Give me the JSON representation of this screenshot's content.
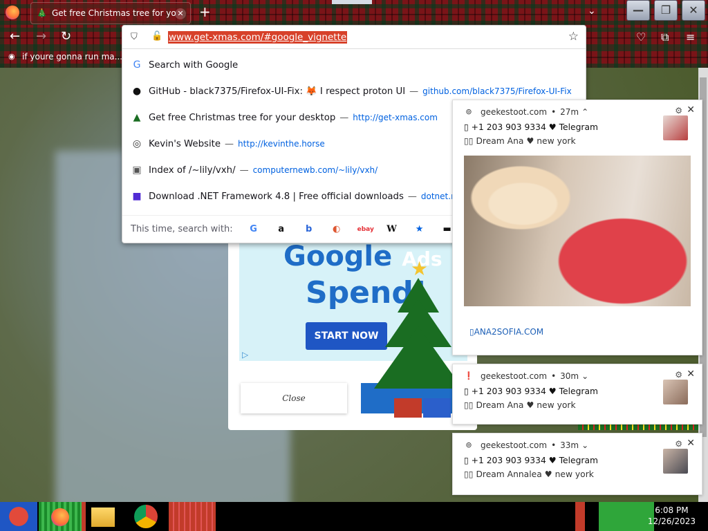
{
  "window": {
    "tab_title": "Get free Christmas tree for your de",
    "tab_close": "✕",
    "new_tab": "+",
    "list_all_tabs": "⌄",
    "min": "—",
    "restore": "❐",
    "close": "✕"
  },
  "nav": {
    "back": "←",
    "forward": "→",
    "reload": "↻",
    "url": "www.get-xmas.com/#google_vignette",
    "bookmark_star": "☆",
    "pocket": "♡",
    "extensions": "⧉",
    "menu": "≡"
  },
  "bookmarks": {
    "item1": "if youre gonna run ma..."
  },
  "dropdown": {
    "rows": [
      {
        "icon": "google-icon",
        "title": "Search with Google",
        "dash": "",
        "url": ""
      },
      {
        "icon": "github-icon",
        "title": "GitHub - black7375/Firefox-UI-Fix: 🦊 I respect proton UI",
        "dash": "—",
        "url": "github.com/black7375/Firefox-UI-Fix"
      },
      {
        "icon": "xmas-tree-icon",
        "title": "Get free Christmas tree for your desktop",
        "dash": "—",
        "url": "http://get-xmas.com"
      },
      {
        "icon": "globe-icon",
        "title": "Kevin's Website",
        "dash": "—",
        "url": "http://kevinthe.horse"
      },
      {
        "icon": "folder-computer-icon",
        "title": "Index of /~lily/vxh/",
        "dash": "—",
        "url": "computernewb.com/~lily/vxh/"
      },
      {
        "icon": "dotnet-icon",
        "title": "Download .NET Framework 4.8 | Free official downloads",
        "dash": "—",
        "url": "dotnet.microsoft"
      }
    ],
    "search_with_label": "This time, search with:",
    "engines": [
      "G",
      "a",
      "b",
      "◐",
      "ebay",
      "W",
      "★",
      "▬"
    ]
  },
  "ad": {
    "headline1": "Google",
    "headline1_suffix": "Ads",
    "headline2": "Spend!",
    "cta": "START NOW",
    "adchoices": "▷",
    "close_label": "Close"
  },
  "notifications": [
    {
      "source": "geekestoot.com",
      "time": "27m",
      "chevron": "⌃",
      "line1": "▯ +1 203 903 9334 ♥ Telegram",
      "line2": "▯▯ Dream Ana ♥ new york",
      "site": "▯ANA2SOFIA.COM"
    },
    {
      "source": "geekestoot.com",
      "time": "30m",
      "chevron": "⌄",
      "line1": "▯ +1 203 903 9334 ♥ Telegram",
      "line2": "▯▯ Dream Ana ♥ new york"
    },
    {
      "source": "geekestoot.com",
      "time": "33m",
      "chevron": "⌄",
      "line1": "▯ +1 203 903 9334 ♥ Telegram",
      "line2": "▯▯ Dream Annalea ♥ new york"
    }
  ],
  "notif_sep": "•",
  "notif_gear": "⚙",
  "notif_close": "✕",
  "taskbar": {
    "time": "6:08 PM",
    "date": "12/26/2023"
  }
}
